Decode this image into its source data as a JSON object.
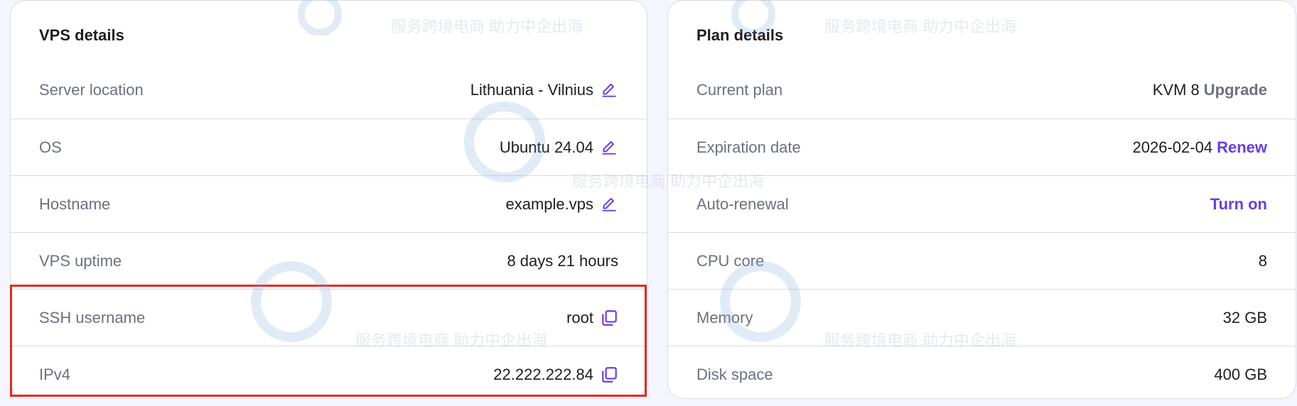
{
  "vps_details": {
    "title": "VPS details",
    "rows": [
      {
        "label": "Server location",
        "value": "Lithuania - Vilnius",
        "action": "edit"
      },
      {
        "label": "OS",
        "value": "Ubuntu 24.04",
        "action": "edit"
      },
      {
        "label": "Hostname",
        "value": "example.vps",
        "action": "edit"
      },
      {
        "label": "VPS uptime",
        "value": "8 days 21 hours"
      },
      {
        "label": "SSH username",
        "value": "root",
        "action": "copy"
      },
      {
        "label": "IPv4",
        "value": "22.222.222.84",
        "action": "copy"
      }
    ]
  },
  "plan_details": {
    "title": "Plan details",
    "rows": [
      {
        "label": "Current plan",
        "value": "KVM 8",
        "link": "Upgrade"
      },
      {
        "label": "Expiration date",
        "value": "2026-02-04",
        "link": "Renew"
      },
      {
        "label": "Auto-renewal",
        "link": "Turn on"
      },
      {
        "label": "CPU core",
        "value": "8"
      },
      {
        "label": "Memory",
        "value": "32 GB"
      },
      {
        "label": "Disk space",
        "value": "400 GB"
      }
    ]
  },
  "watermark": {
    "text": "服务跨境电商 助力中企出海"
  },
  "colors": {
    "accent": "#673de6",
    "highlight": "#e8281b",
    "background": "#f4f5ff"
  },
  "icons": {
    "edit": "pencil-icon",
    "copy": "copy-icon"
  }
}
